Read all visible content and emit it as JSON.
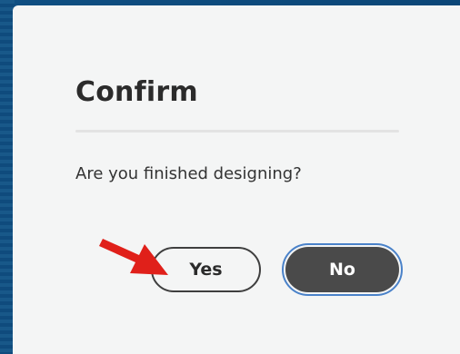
{
  "dialog": {
    "title": "Confirm",
    "message": "Are you finished designing?",
    "buttons": {
      "yes_label": "Yes",
      "no_label": "No"
    },
    "focused_button": "No"
  },
  "annotation": {
    "icon": "red-arrow-icon",
    "target": "Yes",
    "color": "#e0201a"
  },
  "colors": {
    "backdrop": "#0d4a7a",
    "dialog_bg": "#f4f5f5",
    "primary_button": "#4a4a4a",
    "focus_ring": "#4a82c9"
  }
}
